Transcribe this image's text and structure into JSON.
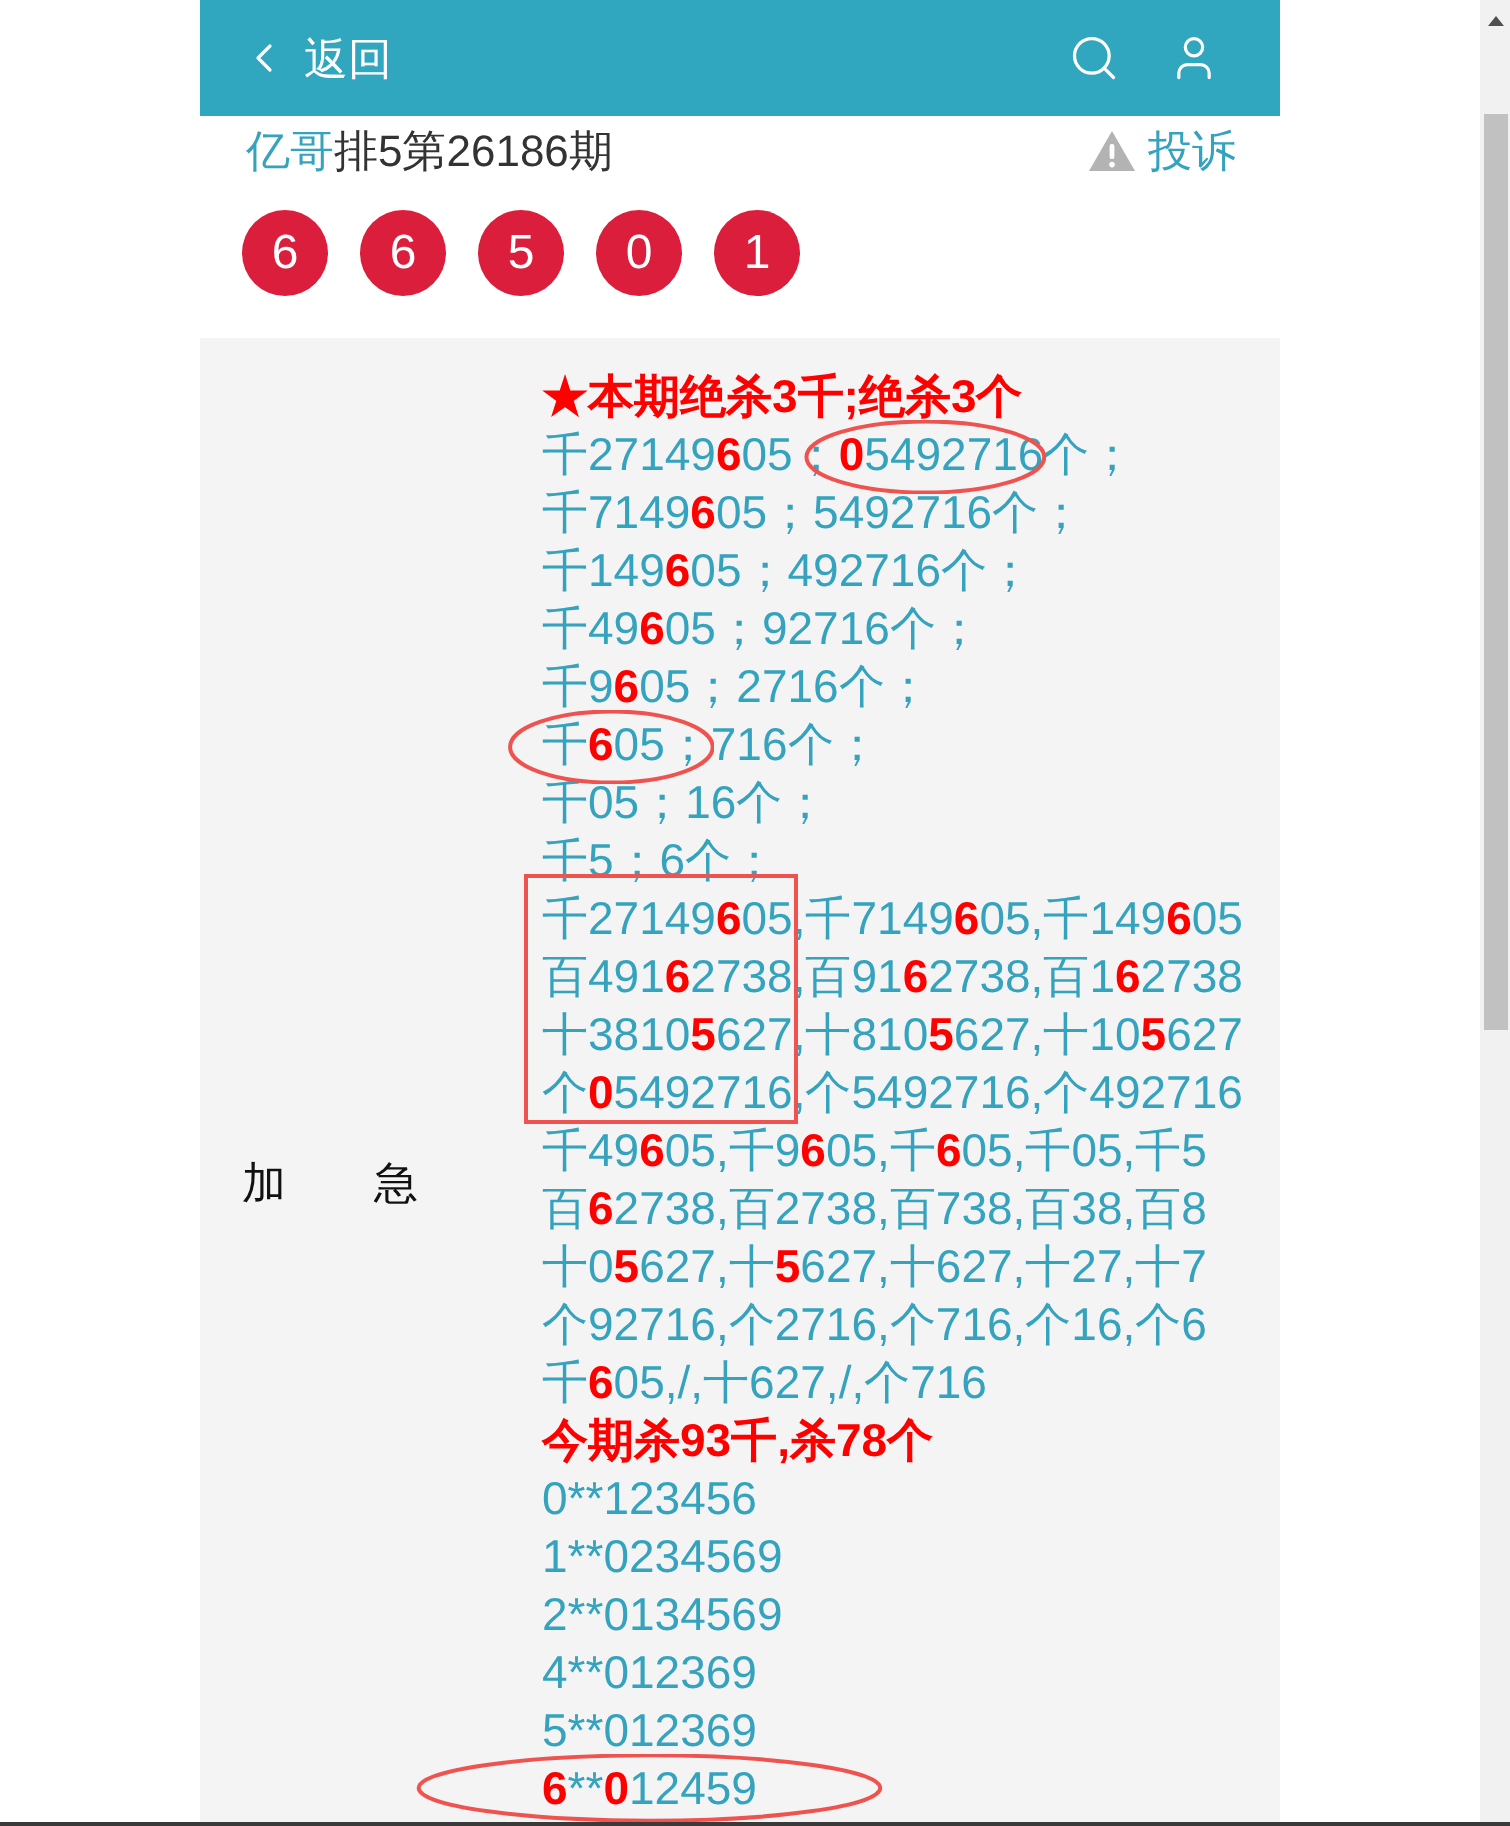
{
  "header": {
    "back_label": "返回"
  },
  "post": {
    "author": "亿哥",
    "title": "排5第26186期",
    "report_label": "投诉"
  },
  "draw_numbers": [
    "6",
    "6",
    "5",
    "0",
    "1"
  ],
  "forecast": {
    "label": "加　　急",
    "lines": [
      {
        "kind": "heading",
        "text": "★本期绝杀3千;绝杀3个"
      },
      {
        "kind": "text",
        "segments": [
          {
            "circled": false,
            "runs": [
              {
                "text": "千27149",
                "highlight": false
              },
              {
                "text": "6",
                "highlight": true
              },
              {
                "text": "05；",
                "highlight": false
              }
            ]
          },
          {
            "circled": true,
            "runs": [
              {
                "text": "0",
                "highlight": true
              },
              {
                "text": "5492716",
                "highlight": false
              }
            ]
          },
          {
            "circled": false,
            "runs": [
              {
                "text": "个；",
                "highlight": false
              }
            ]
          }
        ]
      },
      {
        "kind": "text",
        "segments": [
          {
            "circled": false,
            "runs": [
              {
                "text": "千7149",
                "highlight": false
              },
              {
                "text": "6",
                "highlight": true
              },
              {
                "text": "05；5492716个；",
                "highlight": false
              }
            ]
          }
        ]
      },
      {
        "kind": "text",
        "segments": [
          {
            "circled": false,
            "runs": [
              {
                "text": "千149",
                "highlight": false
              },
              {
                "text": "6",
                "highlight": true
              },
              {
                "text": "05；492716个；",
                "highlight": false
              }
            ]
          }
        ]
      },
      {
        "kind": "text",
        "segments": [
          {
            "circled": false,
            "runs": [
              {
                "text": "千49",
                "highlight": false
              },
              {
                "text": "6",
                "highlight": true
              },
              {
                "text": "05；92716个；",
                "highlight": false
              }
            ]
          }
        ]
      },
      {
        "kind": "text",
        "segments": [
          {
            "circled": false,
            "runs": [
              {
                "text": "千9",
                "highlight": false
              },
              {
                "text": "6",
                "highlight": true
              },
              {
                "text": "05；2716个；",
                "highlight": false
              }
            ]
          }
        ]
      },
      {
        "kind": "text",
        "segments": [
          {
            "circled": true,
            "runs": [
              {
                "text": "千",
                "highlight": false
              },
              {
                "text": "6",
                "highlight": true
              },
              {
                "text": "05；",
                "highlight": false
              }
            ]
          },
          {
            "circled": false,
            "runs": [
              {
                "text": "716个；",
                "highlight": false
              }
            ]
          }
        ]
      },
      {
        "kind": "text",
        "segments": [
          {
            "circled": false,
            "runs": [
              {
                "text": "千05；16个；",
                "highlight": false
              }
            ]
          }
        ]
      },
      {
        "kind": "text",
        "segments": [
          {
            "circled": false,
            "runs": [
              {
                "text": "千5；6个；",
                "highlight": false
              }
            ]
          }
        ]
      },
      {
        "kind": "boxed_group",
        "rows": [
          {
            "inside": [
              {
                "text": "千27149",
                "highlight": false
              },
              {
                "text": "6",
                "highlight": true
              },
              {
                "text": "05",
                "highlight": false
              }
            ],
            "outside": [
              {
                "text": ",千7149",
                "highlight": false
              },
              {
                "text": "6",
                "highlight": true
              },
              {
                "text": "05,千149",
                "highlight": false
              },
              {
                "text": "6",
                "highlight": true
              },
              {
                "text": "05",
                "highlight": false
              }
            ]
          },
          {
            "inside": [
              {
                "text": "百491",
                "highlight": false
              },
              {
                "text": "6",
                "highlight": true
              },
              {
                "text": "2738",
                "highlight": false
              }
            ],
            "outside": [
              {
                "text": ",百91",
                "highlight": false
              },
              {
                "text": "6",
                "highlight": true
              },
              {
                "text": "2738,百1",
                "highlight": false
              },
              {
                "text": "6",
                "highlight": true
              },
              {
                "text": "2738",
                "highlight": false
              }
            ]
          },
          {
            "inside": [
              {
                "text": "十3810",
                "highlight": false
              },
              {
                "text": "5",
                "highlight": true
              },
              {
                "text": "627",
                "highlight": false
              }
            ],
            "outside": [
              {
                "text": ",十810",
                "highlight": false
              },
              {
                "text": "5",
                "highlight": true
              },
              {
                "text": "627,十10",
                "highlight": false
              },
              {
                "text": "5",
                "highlight": true
              },
              {
                "text": "627",
                "highlight": false
              }
            ]
          },
          {
            "inside": [
              {
                "text": "个",
                "highlight": false
              },
              {
                "text": "0",
                "highlight": true
              },
              {
                "text": "5492716",
                "highlight": false
              }
            ],
            "outside": [
              {
                "text": ",个5492716,个492716",
                "highlight": false
              }
            ]
          }
        ]
      },
      {
        "kind": "text",
        "segments": [
          {
            "circled": false,
            "runs": [
              {
                "text": "千49",
                "highlight": false
              },
              {
                "text": "6",
                "highlight": true
              },
              {
                "text": "05,千9",
                "highlight": false
              },
              {
                "text": "6",
                "highlight": true
              },
              {
                "text": "05,千",
                "highlight": false
              },
              {
                "text": "6",
                "highlight": true
              },
              {
                "text": "05,千05,千5",
                "highlight": false
              }
            ]
          }
        ]
      },
      {
        "kind": "text",
        "segments": [
          {
            "circled": false,
            "runs": [
              {
                "text": "百",
                "highlight": false
              },
              {
                "text": "6",
                "highlight": true
              },
              {
                "text": "2738,百2738,百738,百38,百8",
                "highlight": false
              }
            ]
          }
        ]
      },
      {
        "kind": "text",
        "segments": [
          {
            "circled": false,
            "runs": [
              {
                "text": "十0",
                "highlight": false
              },
              {
                "text": "5",
                "highlight": true
              },
              {
                "text": "627,十",
                "highlight": false
              },
              {
                "text": "5",
                "highlight": true
              },
              {
                "text": "627,十627,十27,十7",
                "highlight": false
              }
            ]
          }
        ]
      },
      {
        "kind": "text",
        "segments": [
          {
            "circled": false,
            "runs": [
              {
                "text": "个92716,个2716,个716,个16,个6",
                "highlight": false
              }
            ]
          }
        ]
      },
      {
        "kind": "text",
        "segments": [
          {
            "circled": false,
            "runs": [
              {
                "text": "千",
                "highlight": false
              },
              {
                "text": "6",
                "highlight": true
              },
              {
                "text": "05,/,十627,/,个716",
                "highlight": false
              }
            ]
          }
        ]
      },
      {
        "kind": "heading",
        "text": "今期杀93千,杀78个"
      },
      {
        "kind": "text",
        "segments": [
          {
            "circled": false,
            "runs": [
              {
                "text": "0**123456",
                "highlight": false
              }
            ]
          }
        ]
      },
      {
        "kind": "text",
        "segments": [
          {
            "circled": false,
            "runs": [
              {
                "text": "1**0234569",
                "highlight": false
              }
            ]
          }
        ]
      },
      {
        "kind": "text",
        "segments": [
          {
            "circled": false,
            "runs": [
              {
                "text": "2**0134569",
                "highlight": false
              }
            ]
          }
        ]
      },
      {
        "kind": "text",
        "segments": [
          {
            "circled": false,
            "runs": [
              {
                "text": "4**012369",
                "highlight": false
              }
            ]
          }
        ]
      },
      {
        "kind": "text",
        "segments": [
          {
            "circled": false,
            "runs": [
              {
                "text": "5**012369",
                "highlight": false
              }
            ]
          }
        ]
      },
      {
        "kind": "text",
        "segments": [
          {
            "circled": true,
            "runs": [
              {
                "text": "6",
                "highlight": true
              },
              {
                "text": "**",
                "highlight": false
              },
              {
                "text": "0",
                "highlight": true
              },
              {
                "text": "12459",
                "highlight": false
              }
            ]
          }
        ]
      }
    ]
  }
}
